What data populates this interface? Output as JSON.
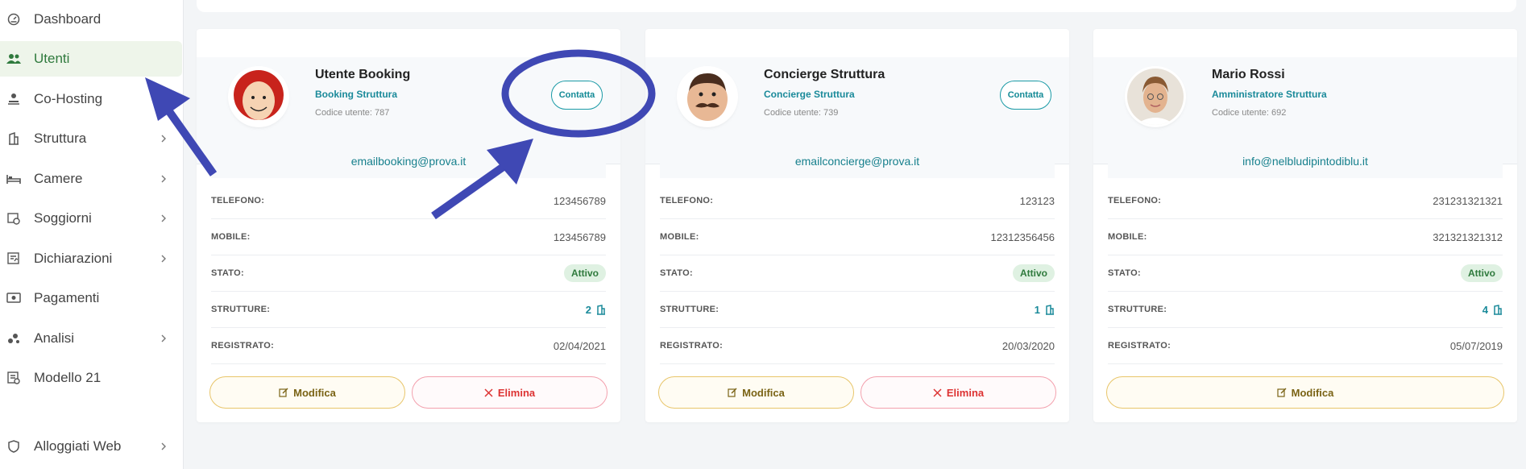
{
  "sidebar": {
    "items": [
      {
        "label": "Dashboard",
        "icon": "dashboard-icon",
        "chevron": false,
        "active": false
      },
      {
        "label": "Utenti",
        "icon": "users-icon",
        "chevron": false,
        "active": true
      },
      {
        "label": "Co-Hosting",
        "icon": "co-hosting-icon",
        "chevron": false,
        "active": false
      },
      {
        "label": "Struttura",
        "icon": "building-icon",
        "chevron": true,
        "active": false
      },
      {
        "label": "Camere",
        "icon": "bed-icon",
        "chevron": true,
        "active": false
      },
      {
        "label": "Soggiorni",
        "icon": "calendar-clock-icon",
        "chevron": true,
        "active": false
      },
      {
        "label": "Dichiarazioni",
        "icon": "document-icon",
        "chevron": true,
        "active": false
      },
      {
        "label": "Pagamenti",
        "icon": "payment-icon",
        "chevron": false,
        "active": false
      },
      {
        "label": "Analisi",
        "icon": "analytics-icon",
        "chevron": true,
        "active": false
      },
      {
        "label": "Modello 21",
        "icon": "form-icon",
        "chevron": false,
        "active": false
      },
      {
        "label": "Alloggiati Web",
        "icon": "shield-icon",
        "chevron": true,
        "active": false
      }
    ]
  },
  "labels": {
    "telefono": "TELEFONO:",
    "mobile": "MOBILE:",
    "stato": "STATO:",
    "strutture": "STRUTTURE:",
    "registrato": "REGISTRATO:",
    "contatta": "Contatta",
    "modifica": "Modifica",
    "elimina": "Elimina"
  },
  "cards": [
    {
      "name": "Utente Booking",
      "role": "Booking Struttura",
      "code": "Codice utente: 787",
      "email": "emailbooking@prova.it",
      "telefono": "123456789",
      "mobile": "123456789",
      "stato": "Attivo",
      "strutture": "2",
      "registrato": "02/04/2021",
      "avatar": "red-hair-avatar",
      "can_delete": true
    },
    {
      "name": "Concierge Struttura",
      "role": "Concierge Struttura",
      "code": "Codice utente: 739",
      "email": "emailconcierge@prova.it",
      "telefono": "123123",
      "mobile": "12312356456",
      "stato": "Attivo",
      "strutture": "1",
      "registrato": "20/03/2020",
      "avatar": "mustache-avatar",
      "can_delete": true
    },
    {
      "name": "Mario Rossi",
      "role": "Amministratore Struttura",
      "code": "Codice utente: 692",
      "email": "info@nelbludipintodiblu.it",
      "telefono": "231231321321",
      "mobile": "321321321312",
      "stato": "Attivo",
      "strutture": "4",
      "registrato": "05/07/2019",
      "avatar": "photo-avatar",
      "can_delete": false
    }
  ],
  "colors": {
    "accent": "#1a8a9a",
    "active_nav": "#2f7a3d",
    "annotation": "#3f48b4",
    "edit": "#e8c56a",
    "delete": "#d33333"
  }
}
